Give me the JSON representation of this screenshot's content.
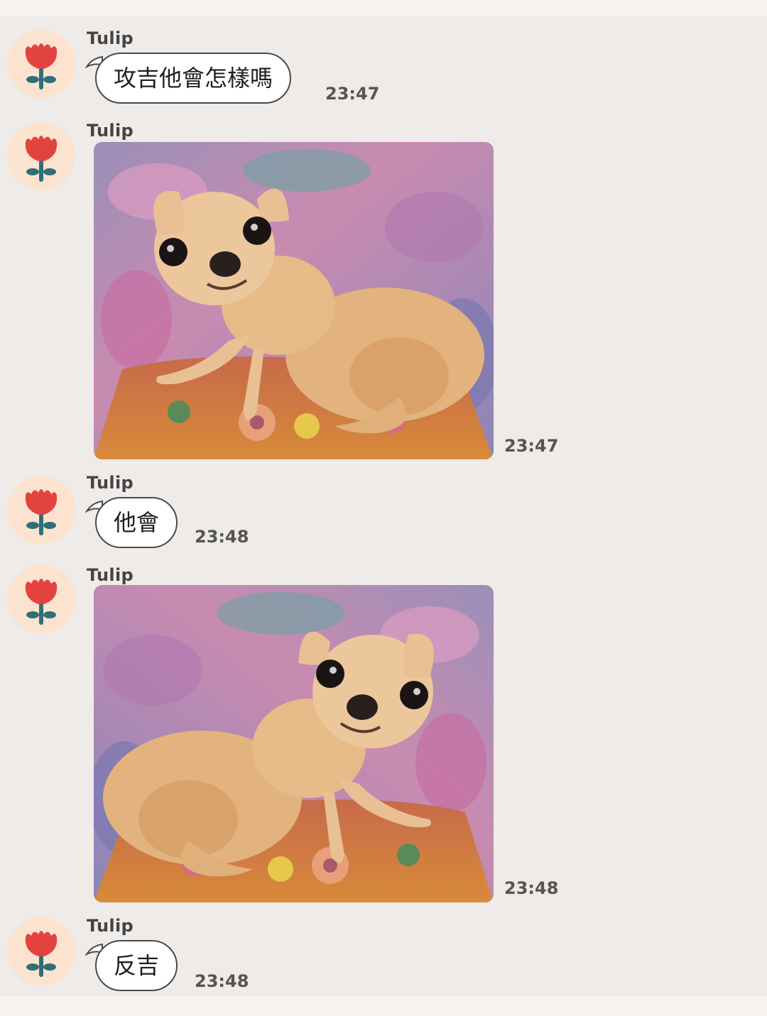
{
  "chat": {
    "messages": [
      {
        "sender": "Tulip",
        "type": "text",
        "text": "攻吉他會怎樣嗎",
        "time": "23:47"
      },
      {
        "sender": "Tulip",
        "type": "image",
        "image": "chihuahua-photo",
        "time": "23:47"
      },
      {
        "sender": "Tulip",
        "type": "text",
        "text": "他會",
        "time": "23:48"
      },
      {
        "sender": "Tulip",
        "type": "image",
        "image": "chihuahua-photo-mirrored",
        "time": "23:48"
      },
      {
        "sender": "Tulip",
        "type": "text",
        "text": "反吉",
        "time": "23:48"
      }
    ]
  },
  "icons": {
    "avatar": "tulip-flower-icon"
  },
  "colors": {
    "background": "#efebe8",
    "avatar_bg": "#fbe3cf",
    "flower_red": "#e3433f",
    "stem_teal": "#2e6f78",
    "bubble_border": "#4a4a4a"
  }
}
